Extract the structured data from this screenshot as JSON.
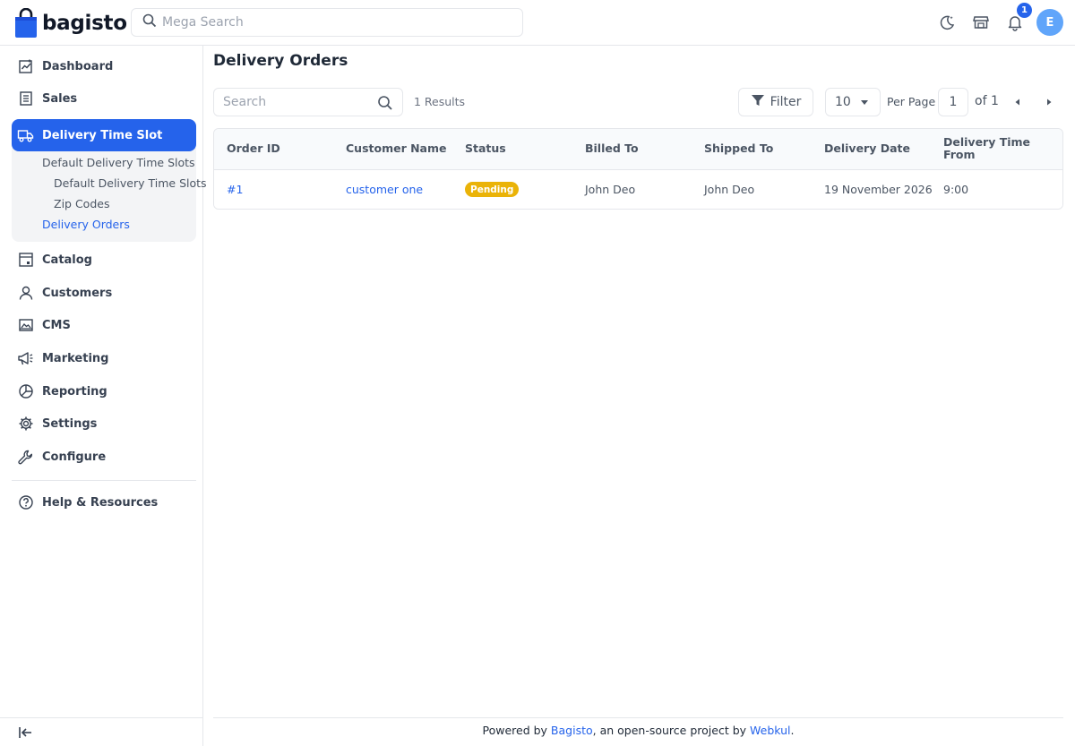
{
  "app": {
    "brand": "bagisto",
    "brand_color": "#2563eb"
  },
  "header": {
    "search_placeholder": "Mega Search",
    "notification_count": "1",
    "avatar_initial": "E",
    "icons": [
      "moon-icon",
      "storefront-icon",
      "bell-icon"
    ]
  },
  "sidebar": {
    "items": [
      {
        "label": "Dashboard",
        "icon": "dashboard-icon"
      },
      {
        "label": "Sales",
        "icon": "receipt-icon"
      },
      {
        "label": "Delivery Time Slot",
        "icon": "delivery-truck-icon",
        "active": true
      },
      {
        "label": "Catalog",
        "icon": "catalog-icon"
      },
      {
        "label": "Customers",
        "icon": "user-icon"
      },
      {
        "label": "CMS",
        "icon": "cms-icon"
      },
      {
        "label": "Marketing",
        "icon": "megaphone-icon"
      },
      {
        "label": "Reporting",
        "icon": "pie-chart-icon"
      },
      {
        "label": "Settings",
        "icon": "gear-icon"
      },
      {
        "label": "Configure",
        "icon": "wrench-icon"
      },
      {
        "label": "Help & Resources",
        "icon": "help-icon"
      }
    ],
    "submenu": [
      {
        "label": "Default Delivery Time Slots"
      },
      {
        "label": "Default Delivery Time Slots"
      },
      {
        "label": "Zip Codes"
      },
      {
        "label": "Delivery Orders",
        "current": true
      }
    ]
  },
  "main": {
    "title": "Delivery Orders",
    "search_placeholder": "Search",
    "results_text": "1 Results",
    "filter_label": "Filter",
    "per_page_value": "10",
    "per_page_label": "Per Page",
    "page_current": "1",
    "page_of": "of 1"
  },
  "table": {
    "columns": [
      "Order ID",
      "Customer Name",
      "Status",
      "Billed To",
      "Shipped To",
      "Delivery Date",
      "Delivery Time From"
    ],
    "rows": [
      {
        "order_id": "#1",
        "customer_name": "customer one",
        "status": "Pending",
        "billed_to": "John Deo",
        "shipped_to": "John Deo",
        "delivery_date": "19 November 2026",
        "delivery_time_from": "9:00"
      }
    ]
  },
  "footer": {
    "prefix": "Powered by ",
    "bagisto_link": "Bagisto",
    "middle": ", an open-source project by ",
    "webkul_link": "Webkul",
    "suffix": "."
  },
  "colors": {
    "accent": "#2563eb",
    "pending": "#eab308",
    "avatar": "#60a5fa"
  }
}
